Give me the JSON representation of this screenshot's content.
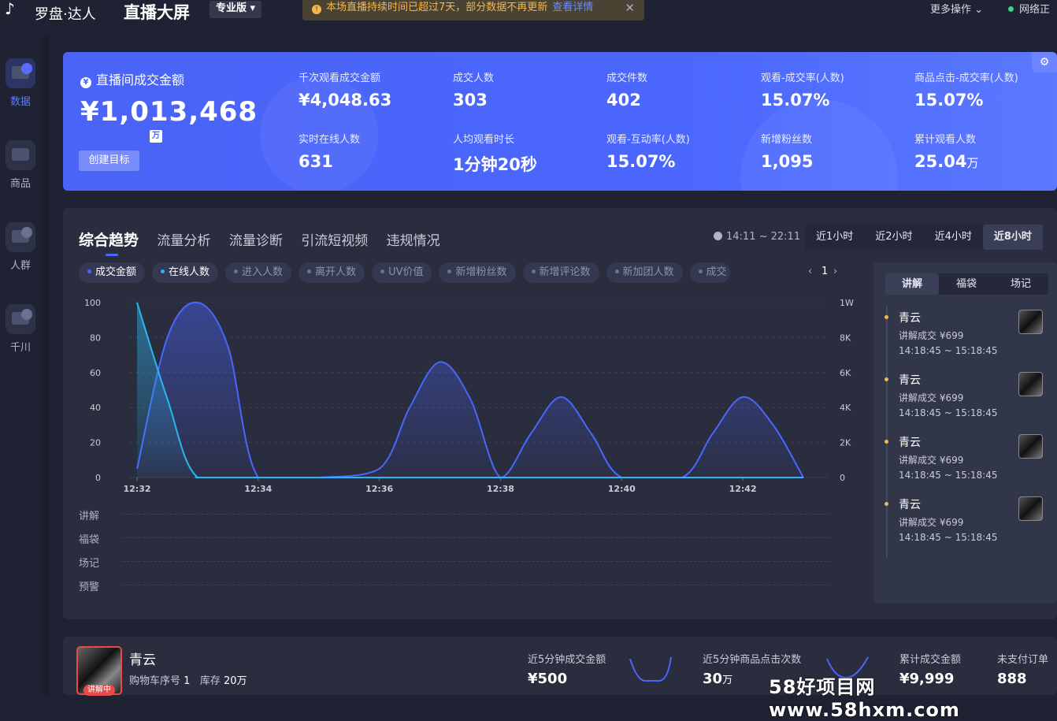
{
  "app": {
    "brand": "罗盘·达人",
    "title": "直播大屏",
    "edition": "专业版"
  },
  "notice": {
    "text": "本场直播持续时间已超过7天，部分数据不再更新",
    "link": "查看详情"
  },
  "topbar": {
    "more_ops": "更多操作",
    "network": "网络正"
  },
  "sidebar": {
    "items": [
      {
        "label": "数据",
        "icon": "data-dashboard-icon"
      },
      {
        "label": "商品",
        "icon": "shopping-cart-icon"
      },
      {
        "label": "人群",
        "icon": "audience-icon"
      },
      {
        "label": "千川",
        "icon": "qianchuan-ads-icon"
      }
    ]
  },
  "kpi": {
    "main_label": "直播间成交金额",
    "main_value": "¥1,013,468",
    "main_unit": "万",
    "goal_button": "创建目标",
    "metrics": [
      {
        "label": "千次观看成交金额",
        "value": "¥4,048.63",
        "unit": ""
      },
      {
        "label": "成交人数",
        "value": "303",
        "unit": ""
      },
      {
        "label": "成交件数",
        "value": "402",
        "unit": ""
      },
      {
        "label": "观看-成交率(人数)",
        "value": "15.07%",
        "unit": ""
      },
      {
        "label": "商品点击-成交率(人数)",
        "value": "15.07%",
        "unit": ""
      },
      {
        "label": "实时在线人数",
        "value": "631",
        "unit": ""
      },
      {
        "label": "人均观看时长",
        "value": "1分钟20秒",
        "unit": ""
      },
      {
        "label": "观看-互动率(人数)",
        "value": "15.07%",
        "unit": ""
      },
      {
        "label": "新增粉丝数",
        "value": "1,095",
        "unit": ""
      },
      {
        "label": "累计观看人数",
        "value": "25.04",
        "unit": "万"
      }
    ]
  },
  "trend": {
    "tabs": [
      "综合趋势",
      "流量分析",
      "流量诊断",
      "引流短视频",
      "违规情况"
    ],
    "time_range": "14:11 ~ 22:11",
    "range_buttons": [
      "近1小时",
      "近2小时",
      "近4小时",
      "近8小时"
    ],
    "chips": [
      "成交金额",
      "在线人数",
      "进入人数",
      "离开人数",
      "UV价值",
      "新增粉丝数",
      "新增评论数",
      "新加团人数",
      "成交"
    ],
    "page": "1",
    "event_rows": [
      "讲解",
      "福袋",
      "场记",
      "预警"
    ]
  },
  "chart_data": {
    "type": "area",
    "x_labels": [
      "12:32",
      "12:34",
      "12:36",
      "12:38",
      "12:40",
      "12:42"
    ],
    "y_left_ticks": [
      "0",
      "20",
      "40",
      "60",
      "80",
      "100"
    ],
    "y_right_ticks": [
      "0",
      "2K",
      "4K",
      "6K",
      "8K",
      "1W"
    ],
    "ylim": [
      0,
      100
    ],
    "series": [
      {
        "name": "成交金额",
        "color": "#4a66fd",
        "x": [
          "12:32",
          "12:32:30",
          "12:33",
          "12:33:30",
          "12:34",
          "12:35",
          "12:36",
          "12:36:30",
          "12:37",
          "12:37:30",
          "12:38",
          "12:38:30",
          "12:39",
          "12:39:30",
          "12:40",
          "12:41",
          "12:41:30",
          "12:42",
          "12:42:30",
          "12:43"
        ],
        "values": [
          5,
          80,
          100,
          75,
          0,
          0,
          5,
          40,
          66,
          45,
          0,
          25,
          46,
          25,
          0,
          0,
          25,
          46,
          30,
          0
        ]
      },
      {
        "name": "在线人数",
        "color": "#2ab6f0",
        "x": [
          "12:32",
          "12:32:30",
          "12:33",
          "12:34",
          "12:43"
        ],
        "values": [
          100,
          45,
          0,
          0,
          0
        ]
      }
    ]
  },
  "side_panel": {
    "tabs": [
      "讲解",
      "福袋",
      "场记"
    ],
    "items": [
      {
        "name": "青云",
        "deal": "讲解成交 ¥699",
        "time": "14:18:45 ~ 15:18:45"
      },
      {
        "name": "青云",
        "deal": "讲解成交 ¥699",
        "time": "14:18:45 ~ 15:18:45"
      },
      {
        "name": "青云",
        "deal": "讲解成交 ¥699",
        "time": "14:18:45 ~ 15:18:45"
      },
      {
        "name": "青云",
        "deal": "讲解成交 ¥699",
        "time": "14:18:45 ~ 15:18:45"
      }
    ]
  },
  "product": {
    "name": "青云",
    "cart_label": "购物车序号",
    "cart_no": "1",
    "stock_label": "库存",
    "stock": "20万",
    "status": "讲解中",
    "stats": [
      {
        "label": "近5分钟成交金额",
        "value": "¥500",
        "unit": ""
      },
      {
        "label": "近5分钟商品点击次数",
        "value": "30",
        "unit": "万"
      },
      {
        "label": "累计成交金额",
        "value": "¥9,999",
        "unit": ""
      },
      {
        "label": "未支付订单",
        "value": "888",
        "unit": ""
      }
    ]
  },
  "watermark": "58好项目网www.58hxm.com"
}
